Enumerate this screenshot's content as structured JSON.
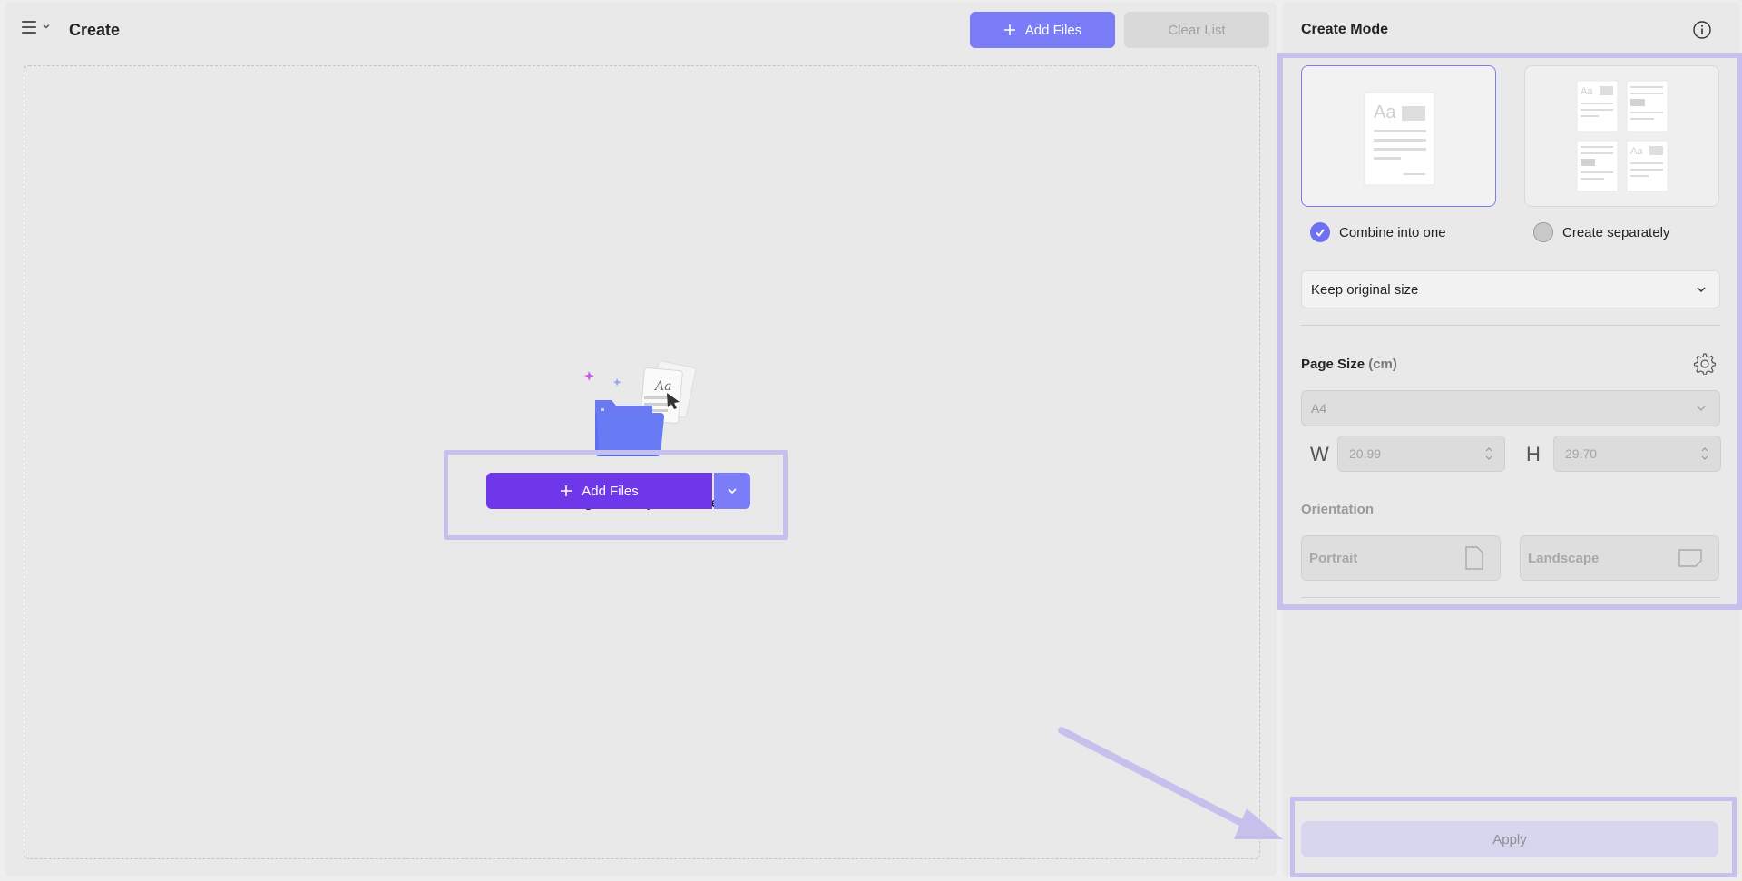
{
  "header": {
    "title": "Create",
    "add_files_label": "Add Files",
    "clear_list_label": "Clear List",
    "menu_icon": "hamburger-icon"
  },
  "dropzone": {
    "instruction": "Drag and drop files here.",
    "add_files_label": "Add Files"
  },
  "right_panel": {
    "title": "Create Mode",
    "modes": [
      {
        "label": "Combine into one",
        "selected": true
      },
      {
        "label": "Create separately",
        "selected": false
      }
    ],
    "size_option": "Keep original size",
    "page_size": {
      "label": "Page Size",
      "unit": "(cm)",
      "preset": "A4",
      "width_label": "W",
      "width_value": "20.99",
      "height_label": "H",
      "height_value": "29.70"
    },
    "orientation": {
      "label": "Orientation",
      "portrait": "Portrait",
      "landscape": "Landscape"
    },
    "apply_label": "Apply"
  },
  "colors": {
    "accent": "#7b7cf7",
    "primary_button": "#6f37ea",
    "highlight": "#c8c0ec",
    "background": "#e9e9e9"
  }
}
